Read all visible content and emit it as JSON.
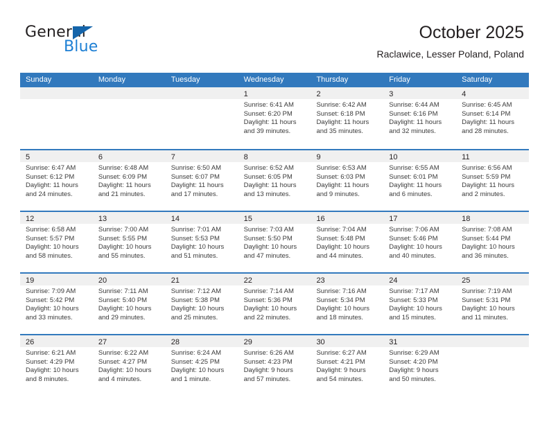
{
  "brand": {
    "name_top": "General",
    "name_bottom": "Blue",
    "triangle_color": "#1464aa",
    "blue_color": "#1d7fd4"
  },
  "header": {
    "title": "October 2025",
    "subtitle": "Raclawice, Lesser Poland, Poland"
  },
  "theme": {
    "header_blue": "#3279bd",
    "daynum_band": "#f0f0f0",
    "text": "#231f20"
  },
  "calendar": {
    "weekday_headers": [
      "Sunday",
      "Monday",
      "Tuesday",
      "Wednesday",
      "Thursday",
      "Friday",
      "Saturday"
    ],
    "weeks": [
      [
        {
          "day": "",
          "sunrise": "",
          "sunset": "",
          "daylight1": "",
          "daylight2": "",
          "empty": true
        },
        {
          "day": "",
          "sunrise": "",
          "sunset": "",
          "daylight1": "",
          "daylight2": "",
          "empty": true
        },
        {
          "day": "",
          "sunrise": "",
          "sunset": "",
          "daylight1": "",
          "daylight2": "",
          "empty": true
        },
        {
          "day": "1",
          "sunrise": "Sunrise: 6:41 AM",
          "sunset": "Sunset: 6:20 PM",
          "daylight1": "Daylight: 11 hours",
          "daylight2": "and 39 minutes."
        },
        {
          "day": "2",
          "sunrise": "Sunrise: 6:42 AM",
          "sunset": "Sunset: 6:18 PM",
          "daylight1": "Daylight: 11 hours",
          "daylight2": "and 35 minutes."
        },
        {
          "day": "3",
          "sunrise": "Sunrise: 6:44 AM",
          "sunset": "Sunset: 6:16 PM",
          "daylight1": "Daylight: 11 hours",
          "daylight2": "and 32 minutes."
        },
        {
          "day": "4",
          "sunrise": "Sunrise: 6:45 AM",
          "sunset": "Sunset: 6:14 PM",
          "daylight1": "Daylight: 11 hours",
          "daylight2": "and 28 minutes."
        }
      ],
      [
        {
          "day": "5",
          "sunrise": "Sunrise: 6:47 AM",
          "sunset": "Sunset: 6:12 PM",
          "daylight1": "Daylight: 11 hours",
          "daylight2": "and 24 minutes."
        },
        {
          "day": "6",
          "sunrise": "Sunrise: 6:48 AM",
          "sunset": "Sunset: 6:09 PM",
          "daylight1": "Daylight: 11 hours",
          "daylight2": "and 21 minutes."
        },
        {
          "day": "7",
          "sunrise": "Sunrise: 6:50 AM",
          "sunset": "Sunset: 6:07 PM",
          "daylight1": "Daylight: 11 hours",
          "daylight2": "and 17 minutes."
        },
        {
          "day": "8",
          "sunrise": "Sunrise: 6:52 AM",
          "sunset": "Sunset: 6:05 PM",
          "daylight1": "Daylight: 11 hours",
          "daylight2": "and 13 minutes."
        },
        {
          "day": "9",
          "sunrise": "Sunrise: 6:53 AM",
          "sunset": "Sunset: 6:03 PM",
          "daylight1": "Daylight: 11 hours",
          "daylight2": "and 9 minutes."
        },
        {
          "day": "10",
          "sunrise": "Sunrise: 6:55 AM",
          "sunset": "Sunset: 6:01 PM",
          "daylight1": "Daylight: 11 hours",
          "daylight2": "and 6 minutes."
        },
        {
          "day": "11",
          "sunrise": "Sunrise: 6:56 AM",
          "sunset": "Sunset: 5:59 PM",
          "daylight1": "Daylight: 11 hours",
          "daylight2": "and 2 minutes."
        }
      ],
      [
        {
          "day": "12",
          "sunrise": "Sunrise: 6:58 AM",
          "sunset": "Sunset: 5:57 PM",
          "daylight1": "Daylight: 10 hours",
          "daylight2": "and 58 minutes."
        },
        {
          "day": "13",
          "sunrise": "Sunrise: 7:00 AM",
          "sunset": "Sunset: 5:55 PM",
          "daylight1": "Daylight: 10 hours",
          "daylight2": "and 55 minutes."
        },
        {
          "day": "14",
          "sunrise": "Sunrise: 7:01 AM",
          "sunset": "Sunset: 5:53 PM",
          "daylight1": "Daylight: 10 hours",
          "daylight2": "and 51 minutes."
        },
        {
          "day": "15",
          "sunrise": "Sunrise: 7:03 AM",
          "sunset": "Sunset: 5:50 PM",
          "daylight1": "Daylight: 10 hours",
          "daylight2": "and 47 minutes."
        },
        {
          "day": "16",
          "sunrise": "Sunrise: 7:04 AM",
          "sunset": "Sunset: 5:48 PM",
          "daylight1": "Daylight: 10 hours",
          "daylight2": "and 44 minutes."
        },
        {
          "day": "17",
          "sunrise": "Sunrise: 7:06 AM",
          "sunset": "Sunset: 5:46 PM",
          "daylight1": "Daylight: 10 hours",
          "daylight2": "and 40 minutes."
        },
        {
          "day": "18",
          "sunrise": "Sunrise: 7:08 AM",
          "sunset": "Sunset: 5:44 PM",
          "daylight1": "Daylight: 10 hours",
          "daylight2": "and 36 minutes."
        }
      ],
      [
        {
          "day": "19",
          "sunrise": "Sunrise: 7:09 AM",
          "sunset": "Sunset: 5:42 PM",
          "daylight1": "Daylight: 10 hours",
          "daylight2": "and 33 minutes."
        },
        {
          "day": "20",
          "sunrise": "Sunrise: 7:11 AM",
          "sunset": "Sunset: 5:40 PM",
          "daylight1": "Daylight: 10 hours",
          "daylight2": "and 29 minutes."
        },
        {
          "day": "21",
          "sunrise": "Sunrise: 7:12 AM",
          "sunset": "Sunset: 5:38 PM",
          "daylight1": "Daylight: 10 hours",
          "daylight2": "and 25 minutes."
        },
        {
          "day": "22",
          "sunrise": "Sunrise: 7:14 AM",
          "sunset": "Sunset: 5:36 PM",
          "daylight1": "Daylight: 10 hours",
          "daylight2": "and 22 minutes."
        },
        {
          "day": "23",
          "sunrise": "Sunrise: 7:16 AM",
          "sunset": "Sunset: 5:34 PM",
          "daylight1": "Daylight: 10 hours",
          "daylight2": "and 18 minutes."
        },
        {
          "day": "24",
          "sunrise": "Sunrise: 7:17 AM",
          "sunset": "Sunset: 5:33 PM",
          "daylight1": "Daylight: 10 hours",
          "daylight2": "and 15 minutes."
        },
        {
          "day": "25",
          "sunrise": "Sunrise: 7:19 AM",
          "sunset": "Sunset: 5:31 PM",
          "daylight1": "Daylight: 10 hours",
          "daylight2": "and 11 minutes."
        }
      ],
      [
        {
          "day": "26",
          "sunrise": "Sunrise: 6:21 AM",
          "sunset": "Sunset: 4:29 PM",
          "daylight1": "Daylight: 10 hours",
          "daylight2": "and 8 minutes."
        },
        {
          "day": "27",
          "sunrise": "Sunrise: 6:22 AM",
          "sunset": "Sunset: 4:27 PM",
          "daylight1": "Daylight: 10 hours",
          "daylight2": "and 4 minutes."
        },
        {
          "day": "28",
          "sunrise": "Sunrise: 6:24 AM",
          "sunset": "Sunset: 4:25 PM",
          "daylight1": "Daylight: 10 hours",
          "daylight2": "and 1 minute."
        },
        {
          "day": "29",
          "sunrise": "Sunrise: 6:26 AM",
          "sunset": "Sunset: 4:23 PM",
          "daylight1": "Daylight: 9 hours",
          "daylight2": "and 57 minutes."
        },
        {
          "day": "30",
          "sunrise": "Sunrise: 6:27 AM",
          "sunset": "Sunset: 4:21 PM",
          "daylight1": "Daylight: 9 hours",
          "daylight2": "and 54 minutes."
        },
        {
          "day": "31",
          "sunrise": "Sunrise: 6:29 AM",
          "sunset": "Sunset: 4:20 PM",
          "daylight1": "Daylight: 9 hours",
          "daylight2": "and 50 minutes."
        },
        {
          "day": "",
          "sunrise": "",
          "sunset": "",
          "daylight1": "",
          "daylight2": "",
          "empty": true
        }
      ]
    ]
  }
}
